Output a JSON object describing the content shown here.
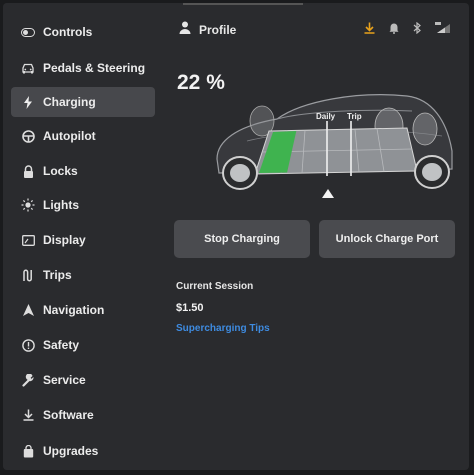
{
  "sidebar": {
    "items": [
      {
        "label": "Controls",
        "icon": "toggle-icon",
        "active": false
      },
      {
        "label": "Pedals & Steering",
        "icon": "car-icon",
        "active": false
      },
      {
        "label": "Charging",
        "icon": "lightning-icon",
        "active": true
      },
      {
        "label": "Autopilot",
        "icon": "steering-wheel-icon",
        "active": false
      },
      {
        "label": "Locks",
        "icon": "lock-icon",
        "active": false
      },
      {
        "label": "Lights",
        "icon": "sun-icon",
        "active": false
      },
      {
        "label": "Display",
        "icon": "display-icon",
        "active": false
      },
      {
        "label": "Trips",
        "icon": "trips-icon",
        "active": false
      },
      {
        "label": "Navigation",
        "icon": "navigation-arrow-icon",
        "active": false
      },
      {
        "label": "Safety",
        "icon": "alert-circle-icon",
        "active": false
      },
      {
        "label": "Service",
        "icon": "wrench-icon",
        "active": false
      },
      {
        "label": "Software",
        "icon": "download-icon",
        "active": false
      },
      {
        "label": "Upgrades",
        "icon": "shopping-bag-icon",
        "active": false
      }
    ]
  },
  "header": {
    "profile_label": "Profile",
    "status_icons": [
      "download-icon",
      "bell-icon",
      "bluetooth-icon",
      "lte-signal-icon"
    ]
  },
  "charging": {
    "battery_percent_label": "22 %",
    "battery_level": 0.22,
    "charge_limit_labels": {
      "daily": "Daily",
      "trip": "Trip"
    },
    "stop_button": "Stop Charging",
    "unlock_button": "Unlock Charge Port",
    "session_label": "Current Session",
    "session_cost": "$1.50",
    "tips_link": "Supercharging Tips"
  },
  "colors": {
    "accent_link": "#3e8be0",
    "battery_fill": "#3fb34f",
    "download_icon": "#e8a21c",
    "active_nav": "#47484c"
  }
}
